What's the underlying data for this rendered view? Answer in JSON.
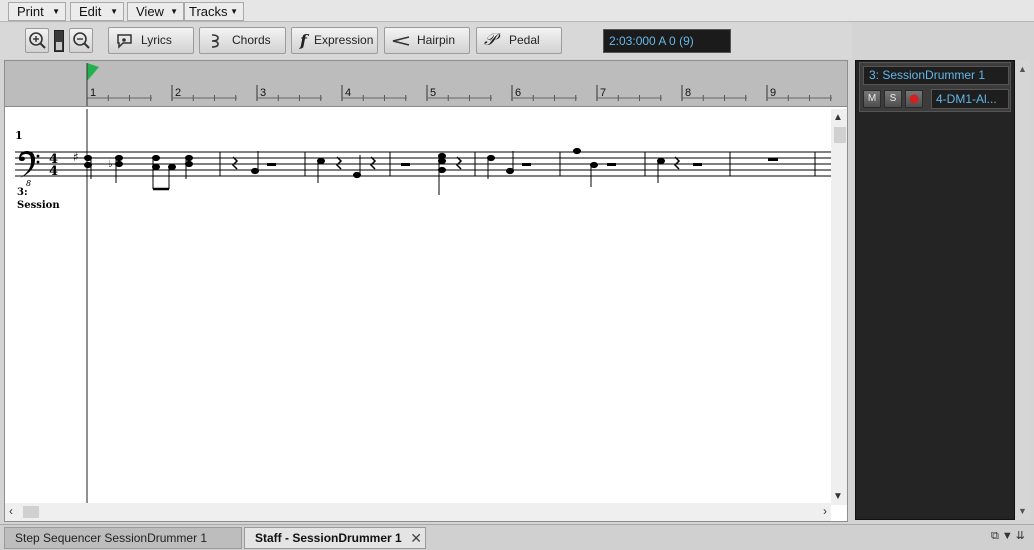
{
  "menu": [
    {
      "label": "Print"
    },
    {
      "label": "Edit"
    },
    {
      "label": "View"
    },
    {
      "label": "Tracks"
    }
  ],
  "toolbar": {
    "zoom_in_icon": "zoom-in-icon",
    "zoom_out_icon": "zoom-out-icon",
    "lyrics_label": "Lyrics",
    "chords_label": "Chords",
    "expression_label": "Expression",
    "hairpin_label": "Hairpin",
    "pedal_label": "Pedal",
    "time_display": "2:03:000  A 0 (9)"
  },
  "ruler": {
    "marks": [
      "1",
      "2",
      "3",
      "4",
      "5",
      "6",
      "7",
      "8",
      "9"
    ],
    "playhead_color": "#22b14c"
  },
  "score": {
    "system_number": "1",
    "time_signature_top": "4",
    "time_signature_bottom": "4",
    "clef_octave": "8",
    "staff_label_line1": "3:",
    "staff_label_line2": "Session"
  },
  "track": {
    "name": "3: SessionDrummer 1",
    "mute_label": "M",
    "solo_label": "S",
    "output": "4-DM1-Al..."
  },
  "tabs": [
    {
      "label": "Step Sequencer SessionDrummer 1"
    },
    {
      "label": "Staff - SessionDrummer 1"
    }
  ],
  "colors": {
    "accent_text": "#63b6e8",
    "record": "#d22020"
  }
}
